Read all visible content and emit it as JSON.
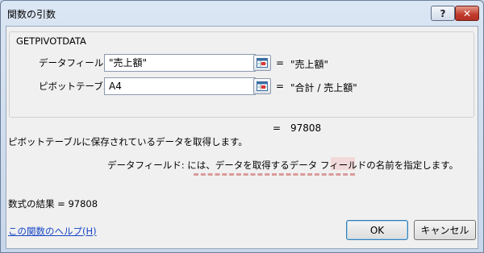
{
  "window": {
    "title": "関数の引数",
    "help_glyph": "?",
    "close_glyph": "✕"
  },
  "function_name": "GETPIVOTDATA",
  "args": [
    {
      "label": "データフィールド",
      "input": "\"売上額\"",
      "equals": "=",
      "value": "\"売上額\""
    },
    {
      "label": "ピボットテーブル",
      "input": "A4",
      "equals": "=",
      "value": "\"合計 / 売上額\""
    }
  ],
  "result_preview": {
    "equals": "=",
    "value": "97808"
  },
  "description": "ピボットテーブルに保存されているデータを取得します。",
  "arg_help": "データフィールド:  には、データを取得するデータ フィールドの名前を指定します。",
  "formula_result": "数式の結果 =   97808",
  "help_link": "この関数のヘルプ(H)",
  "buttons": {
    "ok": "OK",
    "cancel": "キャンセル"
  },
  "icons": {
    "ref": "range-selector-icon"
  }
}
